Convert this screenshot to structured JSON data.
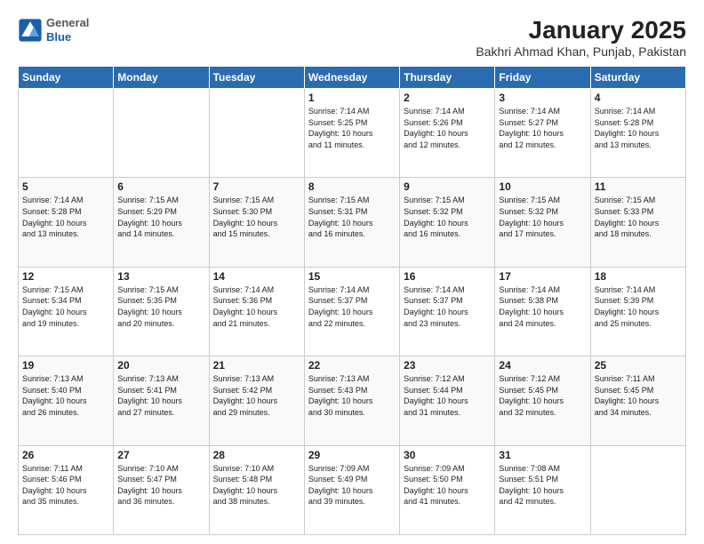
{
  "header": {
    "logo": {
      "general": "General",
      "blue": "Blue"
    },
    "title": "January 2025",
    "subtitle": "Bakhri Ahmad Khan, Punjab, Pakistan"
  },
  "calendar": {
    "weekdays": [
      "Sunday",
      "Monday",
      "Tuesday",
      "Wednesday",
      "Thursday",
      "Friday",
      "Saturday"
    ],
    "weeks": [
      [
        {
          "day": "",
          "info": ""
        },
        {
          "day": "",
          "info": ""
        },
        {
          "day": "",
          "info": ""
        },
        {
          "day": "1",
          "info": "Sunrise: 7:14 AM\nSunset: 5:25 PM\nDaylight: 10 hours\nand 11 minutes."
        },
        {
          "day": "2",
          "info": "Sunrise: 7:14 AM\nSunset: 5:26 PM\nDaylight: 10 hours\nand 12 minutes."
        },
        {
          "day": "3",
          "info": "Sunrise: 7:14 AM\nSunset: 5:27 PM\nDaylight: 10 hours\nand 12 minutes."
        },
        {
          "day": "4",
          "info": "Sunrise: 7:14 AM\nSunset: 5:28 PM\nDaylight: 10 hours\nand 13 minutes."
        }
      ],
      [
        {
          "day": "5",
          "info": "Sunrise: 7:14 AM\nSunset: 5:28 PM\nDaylight: 10 hours\nand 13 minutes."
        },
        {
          "day": "6",
          "info": "Sunrise: 7:15 AM\nSunset: 5:29 PM\nDaylight: 10 hours\nand 14 minutes."
        },
        {
          "day": "7",
          "info": "Sunrise: 7:15 AM\nSunset: 5:30 PM\nDaylight: 10 hours\nand 15 minutes."
        },
        {
          "day": "8",
          "info": "Sunrise: 7:15 AM\nSunset: 5:31 PM\nDaylight: 10 hours\nand 16 minutes."
        },
        {
          "day": "9",
          "info": "Sunrise: 7:15 AM\nSunset: 5:32 PM\nDaylight: 10 hours\nand 16 minutes."
        },
        {
          "day": "10",
          "info": "Sunrise: 7:15 AM\nSunset: 5:32 PM\nDaylight: 10 hours\nand 17 minutes."
        },
        {
          "day": "11",
          "info": "Sunrise: 7:15 AM\nSunset: 5:33 PM\nDaylight: 10 hours\nand 18 minutes."
        }
      ],
      [
        {
          "day": "12",
          "info": "Sunrise: 7:15 AM\nSunset: 5:34 PM\nDaylight: 10 hours\nand 19 minutes."
        },
        {
          "day": "13",
          "info": "Sunrise: 7:15 AM\nSunset: 5:35 PM\nDaylight: 10 hours\nand 20 minutes."
        },
        {
          "day": "14",
          "info": "Sunrise: 7:14 AM\nSunset: 5:36 PM\nDaylight: 10 hours\nand 21 minutes."
        },
        {
          "day": "15",
          "info": "Sunrise: 7:14 AM\nSunset: 5:37 PM\nDaylight: 10 hours\nand 22 minutes."
        },
        {
          "day": "16",
          "info": "Sunrise: 7:14 AM\nSunset: 5:37 PM\nDaylight: 10 hours\nand 23 minutes."
        },
        {
          "day": "17",
          "info": "Sunrise: 7:14 AM\nSunset: 5:38 PM\nDaylight: 10 hours\nand 24 minutes."
        },
        {
          "day": "18",
          "info": "Sunrise: 7:14 AM\nSunset: 5:39 PM\nDaylight: 10 hours\nand 25 minutes."
        }
      ],
      [
        {
          "day": "19",
          "info": "Sunrise: 7:13 AM\nSunset: 5:40 PM\nDaylight: 10 hours\nand 26 minutes."
        },
        {
          "day": "20",
          "info": "Sunrise: 7:13 AM\nSunset: 5:41 PM\nDaylight: 10 hours\nand 27 minutes."
        },
        {
          "day": "21",
          "info": "Sunrise: 7:13 AM\nSunset: 5:42 PM\nDaylight: 10 hours\nand 29 minutes."
        },
        {
          "day": "22",
          "info": "Sunrise: 7:13 AM\nSunset: 5:43 PM\nDaylight: 10 hours\nand 30 minutes."
        },
        {
          "day": "23",
          "info": "Sunrise: 7:12 AM\nSunset: 5:44 PM\nDaylight: 10 hours\nand 31 minutes."
        },
        {
          "day": "24",
          "info": "Sunrise: 7:12 AM\nSunset: 5:45 PM\nDaylight: 10 hours\nand 32 minutes."
        },
        {
          "day": "25",
          "info": "Sunrise: 7:11 AM\nSunset: 5:45 PM\nDaylight: 10 hours\nand 34 minutes."
        }
      ],
      [
        {
          "day": "26",
          "info": "Sunrise: 7:11 AM\nSunset: 5:46 PM\nDaylight: 10 hours\nand 35 minutes."
        },
        {
          "day": "27",
          "info": "Sunrise: 7:10 AM\nSunset: 5:47 PM\nDaylight: 10 hours\nand 36 minutes."
        },
        {
          "day": "28",
          "info": "Sunrise: 7:10 AM\nSunset: 5:48 PM\nDaylight: 10 hours\nand 38 minutes."
        },
        {
          "day": "29",
          "info": "Sunrise: 7:09 AM\nSunset: 5:49 PM\nDaylight: 10 hours\nand 39 minutes."
        },
        {
          "day": "30",
          "info": "Sunrise: 7:09 AM\nSunset: 5:50 PM\nDaylight: 10 hours\nand 41 minutes."
        },
        {
          "day": "31",
          "info": "Sunrise: 7:08 AM\nSunset: 5:51 PM\nDaylight: 10 hours\nand 42 minutes."
        },
        {
          "day": "",
          "info": ""
        }
      ]
    ]
  }
}
